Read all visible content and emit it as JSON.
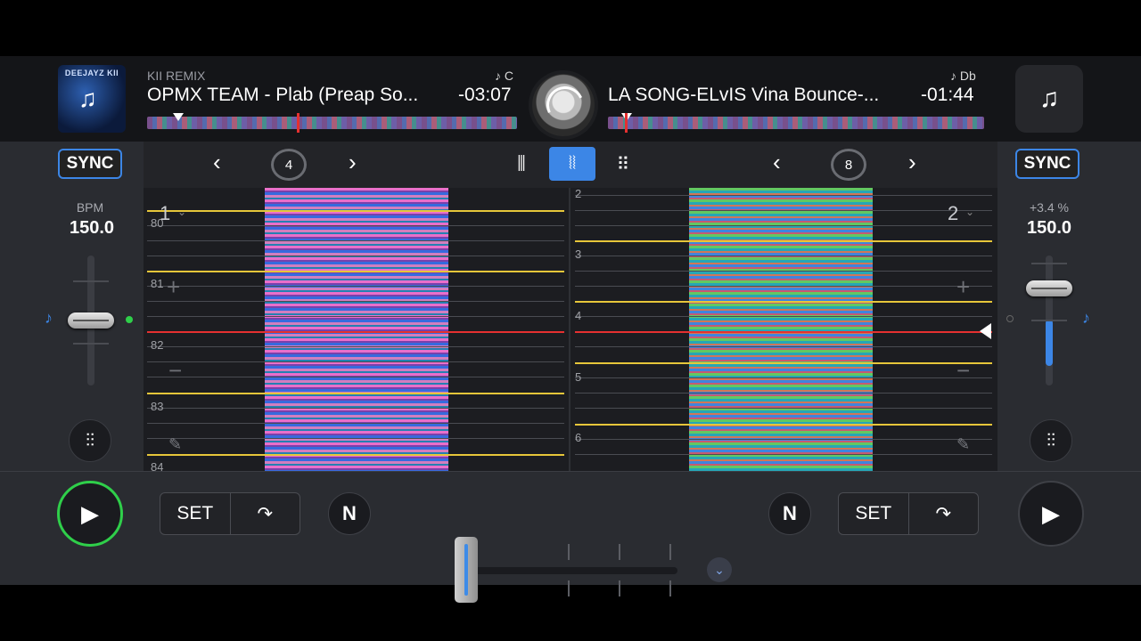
{
  "deck1": {
    "subtitle": "KII REMIX",
    "title": "OPMX TEAM - Plab (Preap So...",
    "time": "-03:07",
    "key": "♪ C",
    "cover_text": "DEEJAYZ KII",
    "sync_label": "SYNC",
    "bpm_label": "BPM",
    "bpm_value": "150.0",
    "deck_number": "1",
    "beats": [
      "80",
      "81",
      "82",
      "83",
      "84"
    ],
    "pitch_level": 0.5,
    "cue_set": "SET",
    "cue_jump": "↷",
    "n_label": "N",
    "loop_beats": "4",
    "play_icon": "play-icon"
  },
  "deck2": {
    "title": "LA SONG-ELvIS Vina Bounce-...",
    "time": "-01:44",
    "key": "♪ Db",
    "sync_label": "SYNC",
    "pitch_percent": "+3.4 %",
    "bpm_value": "150.0",
    "deck_number": "2",
    "beats": [
      "2",
      "3",
      "4",
      "5",
      "6"
    ],
    "pitch_level": 0.75,
    "cue_set": "SET",
    "cue_jump": "↷",
    "n_label": "N",
    "loop_beats": "8",
    "play_icon": "play-icon"
  },
  "toolbar": {
    "prev": "‹",
    "next": "›",
    "mixer_icon": "mixer-icon",
    "waveform_icon": "waveform-icon",
    "pads_icon": "pads-icon"
  },
  "crossfader": {
    "position": 0.0
  },
  "colors": {
    "accent": "#3c86e6",
    "play_ring": "#2fcf4a",
    "beat_line": "#e6c63a",
    "playhead": "#e53030"
  }
}
